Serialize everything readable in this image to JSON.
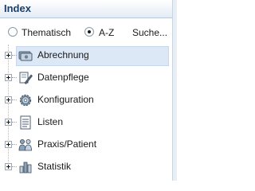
{
  "panel": {
    "title": "Index"
  },
  "filter": {
    "options": [
      {
        "label": "Thematisch",
        "selected": false
      },
      {
        "label": "A-Z",
        "selected": true
      }
    ],
    "search_label": "Suche..."
  },
  "tree": {
    "items": [
      {
        "label": "Abrechnung",
        "icon": "billing-icon",
        "selected": true
      },
      {
        "label": "Datenpflege",
        "icon": "edit-data-icon",
        "selected": false
      },
      {
        "label": "Konfiguration",
        "icon": "gear-icon",
        "selected": false
      },
      {
        "label": "Listen",
        "icon": "list-icon",
        "selected": false
      },
      {
        "label": "Praxis/Patient",
        "icon": "people-icon",
        "selected": false
      },
      {
        "label": "Statistik",
        "icon": "statistics-icon",
        "selected": false
      }
    ]
  }
}
